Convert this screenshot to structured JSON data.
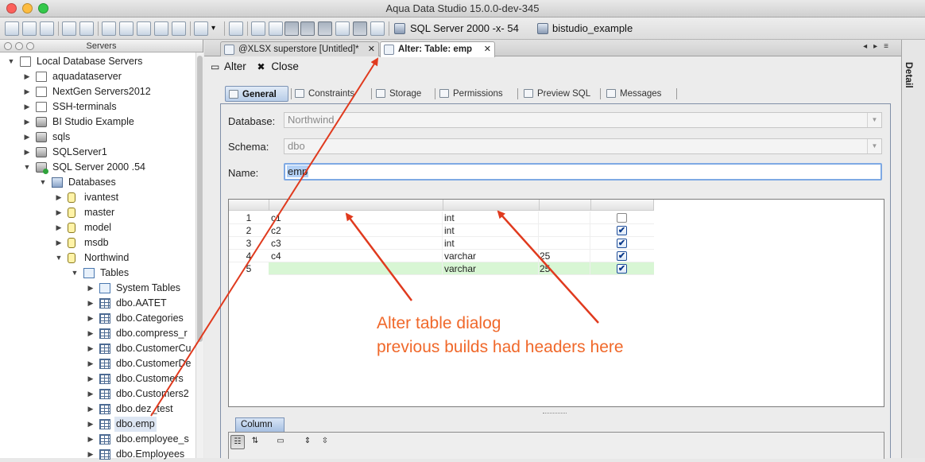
{
  "window": {
    "title": "Aqua Data Studio 15.0.0-dev-345"
  },
  "toolbar": {
    "server_label": "SQL Server 2000 -x- 54",
    "database_label": "bistudio_example"
  },
  "sidebar": {
    "title": "Servers",
    "tree": [
      {
        "label": "Local Database Servers",
        "level": 0,
        "expanded": true,
        "icon": "folder-icon"
      },
      {
        "label": "aquadataserver",
        "level": 1,
        "expanded": false,
        "icon": "folder-icon"
      },
      {
        "label": "NextGen Servers2012",
        "level": 1,
        "expanded": false,
        "icon": "folder-icon"
      },
      {
        "label": "SSH-terminals",
        "level": 1,
        "expanded": false,
        "icon": "folder-icon"
      },
      {
        "label": "BI Studio Example",
        "level": 1,
        "expanded": false,
        "icon": "server-icon"
      },
      {
        "label": "sqls",
        "level": 1,
        "expanded": false,
        "icon": "server-icon"
      },
      {
        "label": "SQLServer1",
        "level": 1,
        "expanded": false,
        "icon": "server-icon"
      },
      {
        "label": "SQL Server 2000 .54",
        "level": 1,
        "expanded": true,
        "icon": "server-connected-icon"
      },
      {
        "label": "Databases",
        "level": 2,
        "expanded": true,
        "icon": "databases-icon"
      },
      {
        "label": "ivantest",
        "level": 3,
        "expanded": false,
        "icon": "database-icon"
      },
      {
        "label": "master",
        "level": 3,
        "expanded": false,
        "icon": "database-icon"
      },
      {
        "label": "model",
        "level": 3,
        "expanded": false,
        "icon": "database-icon"
      },
      {
        "label": "msdb",
        "level": 3,
        "expanded": false,
        "icon": "database-icon"
      },
      {
        "label": "Northwind",
        "level": 3,
        "expanded": true,
        "icon": "database-icon"
      },
      {
        "label": "Tables",
        "level": 4,
        "expanded": true,
        "icon": "tables-folder-icon"
      },
      {
        "label": "System Tables",
        "level": 5,
        "expanded": false,
        "icon": "tables-folder-icon"
      },
      {
        "label": "dbo.AATET",
        "level": 5,
        "expanded": false,
        "icon": "table-icon"
      },
      {
        "label": "dbo.Categories",
        "level": 5,
        "expanded": false,
        "icon": "table-icon"
      },
      {
        "label": "dbo.compress_r",
        "level": 5,
        "expanded": false,
        "icon": "table-icon"
      },
      {
        "label": "dbo.CustomerCu",
        "level": 5,
        "expanded": false,
        "icon": "table-icon"
      },
      {
        "label": "dbo.CustomerDe",
        "level": 5,
        "expanded": false,
        "icon": "table-icon"
      },
      {
        "label": "dbo.Customers",
        "level": 5,
        "expanded": false,
        "icon": "table-icon"
      },
      {
        "label": "dbo.Customers2",
        "level": 5,
        "expanded": false,
        "icon": "table-icon"
      },
      {
        "label": "dbo.dez_test",
        "level": 5,
        "expanded": false,
        "icon": "table-icon"
      },
      {
        "label": "dbo.emp",
        "level": 5,
        "expanded": false,
        "icon": "table-icon",
        "selected": true
      },
      {
        "label": "dbo.employee_s",
        "level": 5,
        "expanded": false,
        "icon": "table-icon"
      },
      {
        "label": "dbo.Employees",
        "level": 5,
        "expanded": false,
        "icon": "table-icon"
      }
    ]
  },
  "tabs": [
    {
      "label": "@XLSX superstore [Untitled]*",
      "close": "✕",
      "active": false
    },
    {
      "label": "Alter: Table: emp",
      "close": "✕",
      "active": true
    }
  ],
  "actions": {
    "alter": "Alter",
    "close": "Close",
    "alter_glyph": "▭",
    "close_glyph": "✖"
  },
  "subtabs": [
    "General",
    "Constraints",
    "Storage",
    "Permissions",
    "Preview SQL",
    "Messages"
  ],
  "form": {
    "database_label": "Database:",
    "database_value": "Northwind",
    "schema_label": "Schema:",
    "schema_value": "dbo",
    "name_label": "Name:",
    "name_value": "emp"
  },
  "columns_grid": {
    "rows": [
      {
        "num": "1",
        "name": "c1",
        "type": "int",
        "size": "",
        "checked": false
      },
      {
        "num": "2",
        "name": "c2",
        "type": "int",
        "size": "",
        "checked": true
      },
      {
        "num": "3",
        "name": "c3",
        "type": "int",
        "size": "",
        "checked": true
      },
      {
        "num": "4",
        "name": "c4",
        "type": "varchar",
        "size": "25",
        "checked": true
      },
      {
        "num": "5",
        "name": "",
        "type": "varchar",
        "size": "25",
        "checked": true,
        "new": true
      }
    ]
  },
  "column_panel": {
    "tab_label": "Column"
  },
  "right_strip": {
    "label": "Detail"
  },
  "annotation": {
    "line1": "Alter table dialog",
    "line2": "previous builds had headers here",
    "color": "#f0682a",
    "arrow_color": "#e03a1e"
  }
}
